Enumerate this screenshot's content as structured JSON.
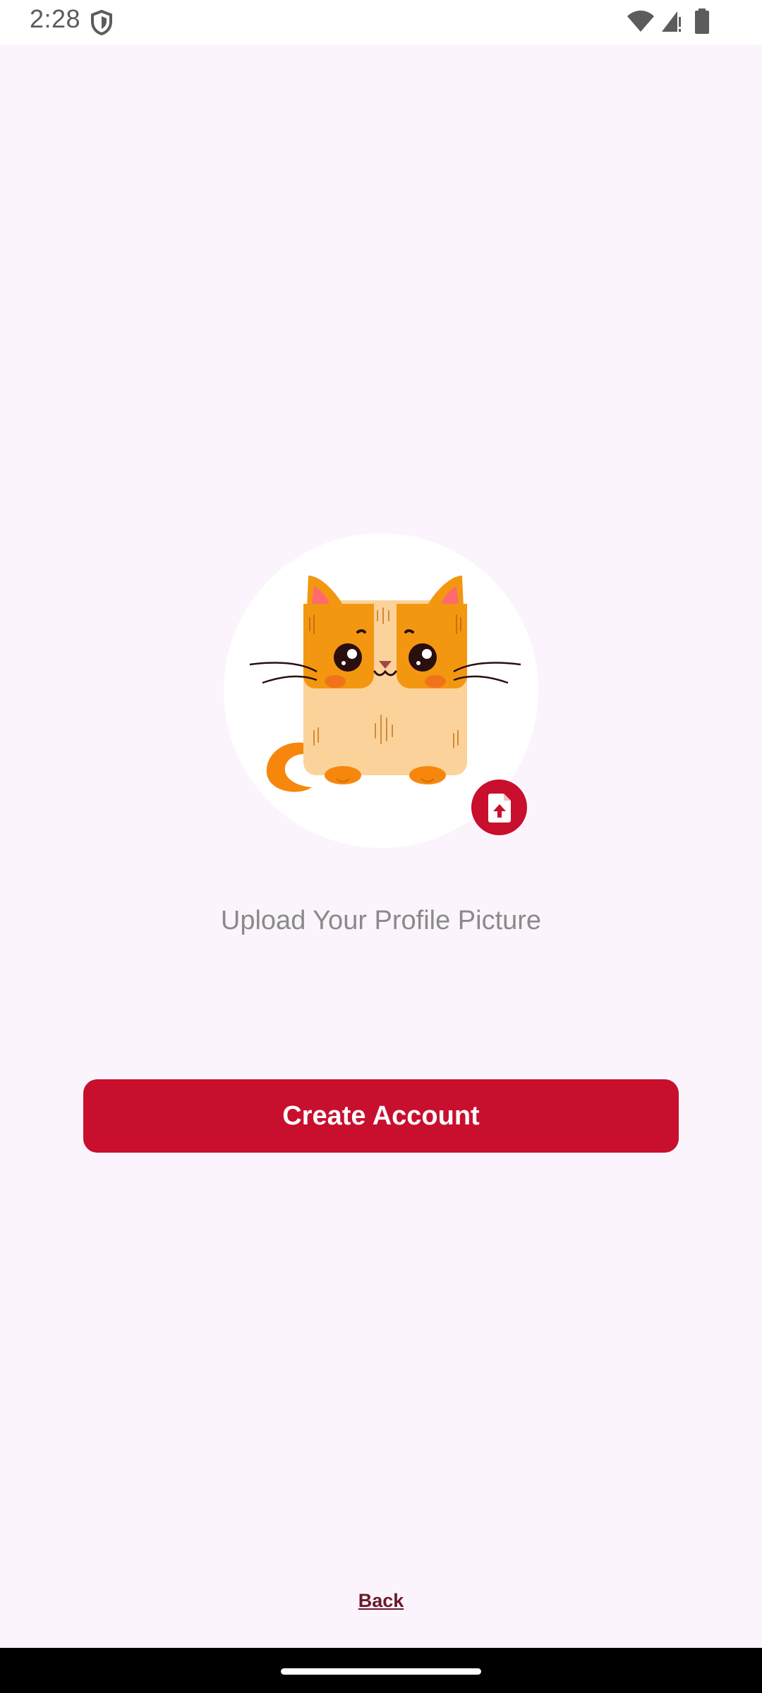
{
  "status_bar": {
    "time": "2:28",
    "icons": [
      "shield-icon",
      "wifi-icon",
      "cellular-icon",
      "battery-icon"
    ]
  },
  "profile": {
    "avatar_icon": "cat-illustration",
    "upload_icon": "file-upload-icon",
    "upload_label": "Upload Your Profile Picture"
  },
  "actions": {
    "create_account_label": "Create Account",
    "back_label": "Back"
  },
  "colors": {
    "background": "#fcf4fc",
    "accent": "#c80f2e",
    "back_link": "#6b1a2a",
    "label_gray": "#8a8a8a"
  }
}
